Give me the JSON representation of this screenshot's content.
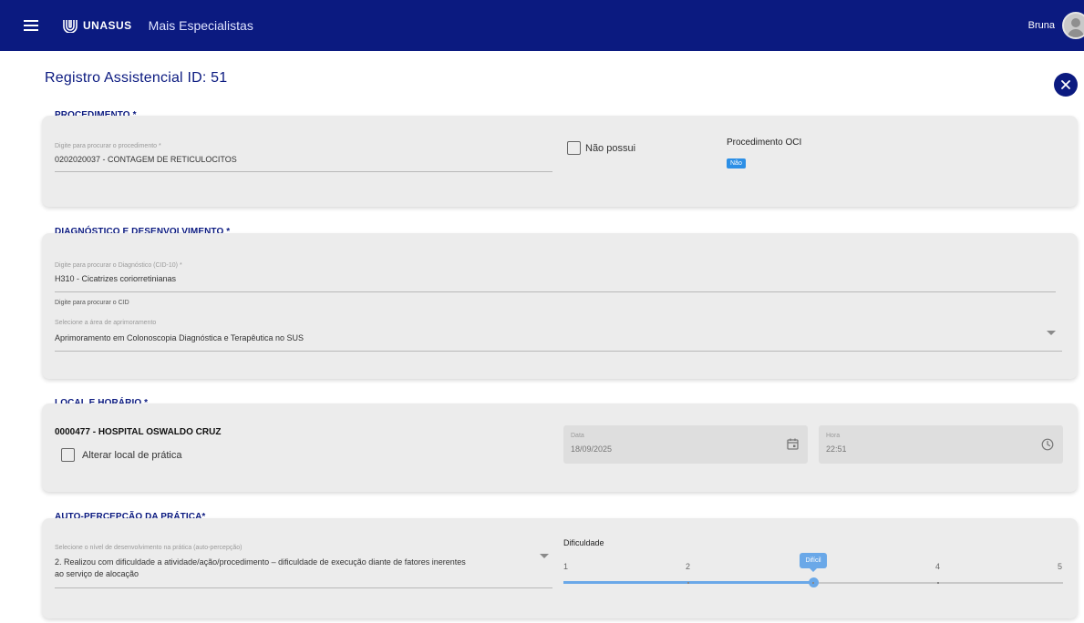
{
  "appbar": {
    "logo_text": "UNASUS",
    "app_name": "Mais Especialistas",
    "user_name": "Bruna"
  },
  "page": {
    "title": "Registro Assistencial ID: 51"
  },
  "procedimento": {
    "section_title": "PROCEDIMENTO *",
    "search_label": "Digite para procurar o procedimento *",
    "search_value": "0202020037 - CONTAGEM DE RETICULOCITOS",
    "nao_possui_label": "Não possui",
    "oci_title": "Procedimento OCI",
    "oci_badge": "Não"
  },
  "diagnostico": {
    "section_title": "DIAGNÓSTICO E DESENVOLVIMENTO *",
    "cid_label": "Digite para procurar o Diagnóstico (CID-10) *",
    "cid_value": "H310 - Cicatrizes coriorretinianas",
    "cid_hint": "Digite para procurar o CID",
    "area_label": "Selecione a área de aprimoramento",
    "area_value": "Aprimoramento em Colonoscopia Diagnóstica e Terapêutica no SUS"
  },
  "local": {
    "section_title": "LOCAL E HORÁRIO *",
    "hospital": "0000477 - HOSPITAL OSWALDO CRUZ",
    "alterar_label": "Alterar local de prática",
    "data_label": "Data",
    "data_value": "18/09/2025",
    "hora_label": "Hora",
    "hora_value": "22:51"
  },
  "autopercepcao": {
    "section_title": "AUTO-PERCEPÇÃO DA PRÁTICA*",
    "nivel_label": "Selecione o nível de desenvolvimento na prática (auto-percepção)",
    "nivel_value_line1": "2. Realizou com dificuldade a atividade/ação/procedimento – dificuldade de execução diante de fatores inerentes",
    "nivel_value_line2": "ao serviço de alocação",
    "dificuldade_title": "Dificuldade",
    "ticks": [
      "1",
      "2",
      "3",
      "4",
      "5"
    ],
    "selected_value": 3,
    "selected_tip": "Difícil"
  },
  "colors": {
    "brand": "#0b1a80",
    "slider": "#6aa8e8",
    "badge": "#2c8fe6"
  }
}
